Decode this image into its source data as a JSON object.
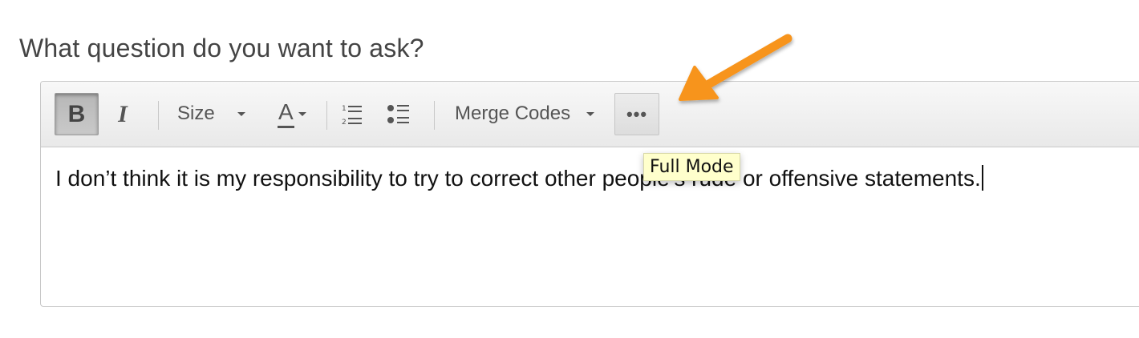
{
  "question": {
    "label": "What question do you want to ask?"
  },
  "toolbar": {
    "bold_label": "B",
    "italic_label": "I",
    "size_label": "Size",
    "font_color_label": "A",
    "merge_codes_label": "Merge Codes",
    "more_label": "•••"
  },
  "editor": {
    "text": "I don’t think it is my responsibility to try to correct other people’s rude or offensive statements."
  },
  "tooltip": {
    "text": "Full Mode"
  },
  "icons": [
    "numbered-list-icon",
    "bulleted-list-icon",
    "chevron-down-icon",
    "arrow-annotation-icon"
  ],
  "colors": {
    "annotation_arrow": "#f7941d",
    "tooltip_background": "#ffffcc",
    "toolbar_background": "#ececec"
  }
}
